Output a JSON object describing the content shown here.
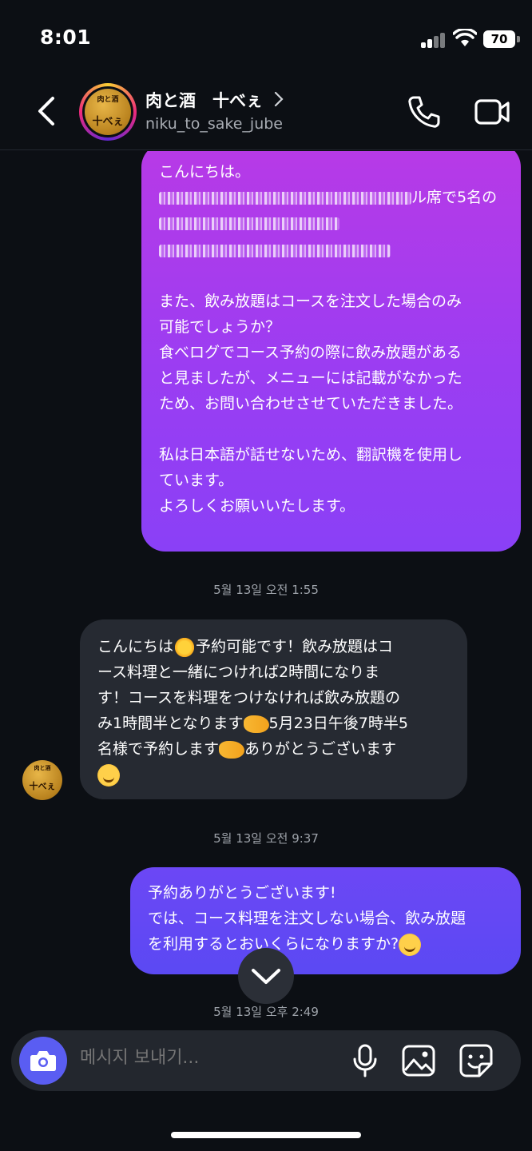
{
  "status_bar": {
    "time": "8:01",
    "battery": "70"
  },
  "header": {
    "title": "肉と酒　十べぇ",
    "username": "niku_to_sake_jube",
    "avatar_text_top": "肉と酒",
    "avatar_text_main": "十べぇ"
  },
  "messages": {
    "out_1": {
      "line1": "こんにちは。",
      "line2_suffix": "ル席で5名の",
      "para2": "また、飲み放題はコースを注文した場合のみ\n可能でしょうか？\n食べログでコース予約の際に飲み放題がある\nと見ましたが、メニューには記載がなかった\nため、お問い合わせさせていただきました。",
      "para3": "私は日本語が話せないため、翻訳機を使用し\nています。\nよろしくお願いいたします。"
    },
    "ts_1": "5월 13일 오전 1:55",
    "in_1": {
      "part1": "こんにちは",
      "part2": "予約可能です！飲み放題はコ\nース料理と一緒につければ2時間になりま\nす！コースを料理をつけなければ飲み放題の\nみ1時間半となります",
      "part3": "5月23日午後7時半5\n名様で予約します",
      "part4": "ありがとうございます"
    },
    "ts_2": "5월 13일 오전 9:37",
    "out_2": {
      "text": "予約ありがとうございます!\nでは、コース料理を注文しない場合、飲み放題\nを利用するとおいくらになりますか?"
    },
    "ts_3": "5월 13일 오후 2:49"
  },
  "composer": {
    "placeholder": "메시지 보내기..."
  },
  "icons": [
    "back-arrow-icon",
    "chevron-right-icon",
    "phone-icon",
    "video-camera-icon",
    "chevron-down-icon",
    "camera-icon",
    "microphone-icon",
    "gallery-icon",
    "sticker-icon"
  ],
  "colors": {
    "background": "#0c0f14",
    "outgoing_top": "#b83ae6",
    "outgoing_bottom": "#5b49f3",
    "incoming": "#262a32",
    "camera_button": "#5a5df2"
  }
}
